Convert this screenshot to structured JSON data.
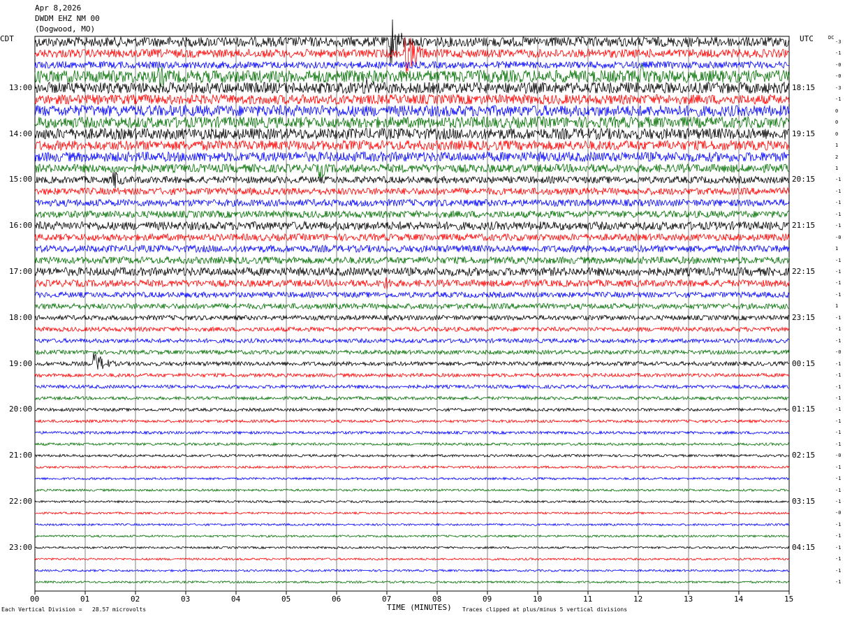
{
  "header": {
    "date": "Apr 8,2026",
    "station": "DWDM EHZ NM 00",
    "location": "(Dogwood, MO)"
  },
  "chart_data": {
    "type": "line",
    "title": "DWDM EHZ NM 00",
    "left_zone": "CDT",
    "right_zone": "UTC",
    "dc_header": "DC",
    "left_hour_labels": [
      "13:00",
      "14:00",
      "15:00",
      "16:00",
      "17:00",
      "18:00",
      "19:00",
      "20:00",
      "21:00",
      "22:00",
      "23:00"
    ],
    "right_hour_labels": [
      "18:15",
      "19:15",
      "20:15",
      "21:15",
      "22:15",
      "23:15",
      "00:15",
      "01:15",
      "02:15",
      "03:15",
      "04:15"
    ],
    "first_labeled_trace": 4,
    "traces_per_hour": 4,
    "trace_count": 48,
    "trace_colors": [
      "#000000",
      "#ff0000",
      "#0000ff",
      "#007000"
    ],
    "dc_offsets": [
      "-3",
      "-1",
      "-0",
      "-0",
      "-3",
      "-1",
      "0",
      "0",
      "0",
      "1",
      "2",
      "1",
      "-1",
      "-1",
      "-1",
      "-1",
      "-1",
      "-0",
      "1",
      "-1",
      "-1",
      "-1",
      "-1",
      "1",
      "-1",
      "-1",
      "-1",
      "-0",
      "-1",
      "-1",
      "-1",
      "-1",
      "-1",
      "-1",
      "-1",
      "-1",
      "-0",
      "-1",
      "-1",
      "-1",
      "-1",
      "-0",
      "-1",
      "-1",
      "-1",
      "-1",
      "-1",
      "-1"
    ],
    "x_ticks": [
      "00",
      "01",
      "02",
      "03",
      "04",
      "05",
      "06",
      "07",
      "08",
      "09",
      "10",
      "11",
      "12",
      "13",
      "14",
      "15"
    ],
    "xlabel": "TIME (MINUTES)",
    "xlim": [
      0,
      15
    ],
    "amplitude_by_trace": [
      7,
      6,
      5,
      9,
      8,
      7,
      8,
      8,
      8,
      7,
      7,
      6,
      5,
      5,
      5,
      5,
      6,
      5,
      5,
      5,
      6,
      5,
      4,
      4,
      3.5,
      3.2,
      3,
      3,
      3,
      2.6,
      2.5,
      2.3,
      2.2,
      2,
      2,
      1.9,
      1.8,
      1.7,
      1.6,
      1.6,
      1.5,
      1.5,
      1.5,
      1.5,
      1.5,
      1.5,
      1.5,
      1.5
    ],
    "events": [
      {
        "trace": 0,
        "minute": 7.1,
        "peak": 40,
        "duration_min": 0.4
      },
      {
        "trace": 1,
        "minute": 7.4,
        "peak": 30,
        "duration_min": 0.6
      },
      {
        "trace": 3,
        "minute": 12.1,
        "peak": 22,
        "duration_min": 0.4
      },
      {
        "trace": 3,
        "minute": 2.5,
        "peak": 18,
        "duration_min": 0.5
      },
      {
        "trace": 4,
        "minute": 6.6,
        "peak": 18,
        "duration_min": 0.5
      },
      {
        "trace": 12,
        "minute": 1.6,
        "peak": 14,
        "duration_min": 0.4
      },
      {
        "trace": 11,
        "minute": 5.7,
        "peak": 16,
        "duration_min": 0.3
      },
      {
        "trace": 21,
        "minute": 7.0,
        "peak": 12,
        "duration_min": 0.3
      },
      {
        "trace": 28,
        "minute": 1.2,
        "peak": 16,
        "duration_min": 0.6
      }
    ],
    "footer_left": "Each Vertical Division =   28.57 microvolts",
    "footer_right": "Traces clipped at plus/minus 5 vertical divisions"
  }
}
